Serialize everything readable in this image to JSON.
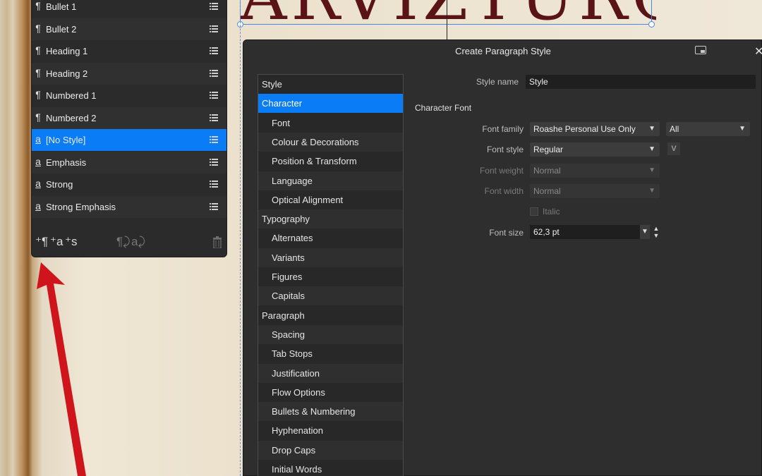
{
  "canvas": {
    "title_art_text": "ARVIZTURO"
  },
  "styles_panel": {
    "items": [
      {
        "label": "Bullet 1",
        "kind": "paragraph",
        "icon": "¶"
      },
      {
        "label": "Bullet 2",
        "kind": "paragraph",
        "icon": "¶"
      },
      {
        "label": "Heading 1",
        "kind": "paragraph",
        "icon": "¶"
      },
      {
        "label": "Heading 2",
        "kind": "paragraph",
        "icon": "¶"
      },
      {
        "label": "Numbered 1",
        "kind": "paragraph",
        "icon": "¶"
      },
      {
        "label": "Numbered 2",
        "kind": "paragraph",
        "icon": "¶"
      },
      {
        "label": "[No Style]",
        "kind": "character",
        "icon": "a",
        "selected": true
      },
      {
        "label": "Emphasis",
        "kind": "character",
        "icon": "a"
      },
      {
        "label": "Strong",
        "kind": "character",
        "icon": "a"
      },
      {
        "label": "Strong Emphasis",
        "kind": "character",
        "icon": "a"
      }
    ],
    "footer": {
      "new_paragraph": "⁺¶",
      "new_character": "⁺a",
      "new_group": "⁺s",
      "apply_paragraph": "¶⤸",
      "apply_character": "a⤸",
      "delete_icon": "trash-icon"
    }
  },
  "dialog": {
    "title": "Create Paragraph Style",
    "categories": [
      {
        "label": "Style",
        "level": "head"
      },
      {
        "label": "Character",
        "level": "head",
        "selected": true
      },
      {
        "label": "Font",
        "level": "sub"
      },
      {
        "label": "Colour & Decorations",
        "level": "sub"
      },
      {
        "label": "Position & Transform",
        "level": "sub"
      },
      {
        "label": "Language",
        "level": "sub"
      },
      {
        "label": "Optical Alignment",
        "level": "sub"
      },
      {
        "label": "Typography",
        "level": "head"
      },
      {
        "label": "Alternates",
        "level": "sub"
      },
      {
        "label": "Variants",
        "level": "sub"
      },
      {
        "label": "Figures",
        "level": "sub"
      },
      {
        "label": "Capitals",
        "level": "sub"
      },
      {
        "label": "Paragraph",
        "level": "head"
      },
      {
        "label": "Spacing",
        "level": "sub"
      },
      {
        "label": "Tab Stops",
        "level": "sub"
      },
      {
        "label": "Justification",
        "level": "sub"
      },
      {
        "label": "Flow Options",
        "level": "sub"
      },
      {
        "label": "Bullets & Numbering",
        "level": "sub"
      },
      {
        "label": "Hyphenation",
        "level": "sub"
      },
      {
        "label": "Drop Caps",
        "level": "sub"
      },
      {
        "label": "Initial Words",
        "level": "sub"
      }
    ],
    "style_name_label": "Style name",
    "style_name_value": "Style",
    "section_title": "Character Font",
    "font_family_label": "Font family",
    "font_family_value": "Roashe Personal Use Only",
    "font_collection_value": "All",
    "font_style_label": "Font style",
    "font_style_value": "Regular",
    "font_weight_label": "Font weight",
    "font_weight_value": "Normal",
    "font_width_label": "Font width",
    "font_width_value": "Normal",
    "italic_label": "Italic",
    "font_size_label": "Font size",
    "font_size_value": "62,3 pt"
  },
  "colors": {
    "accent": "#0a7cf5",
    "panel_bg": "#2b2b2b",
    "arrow": "#d0141b",
    "title_art": "#5a1418"
  }
}
